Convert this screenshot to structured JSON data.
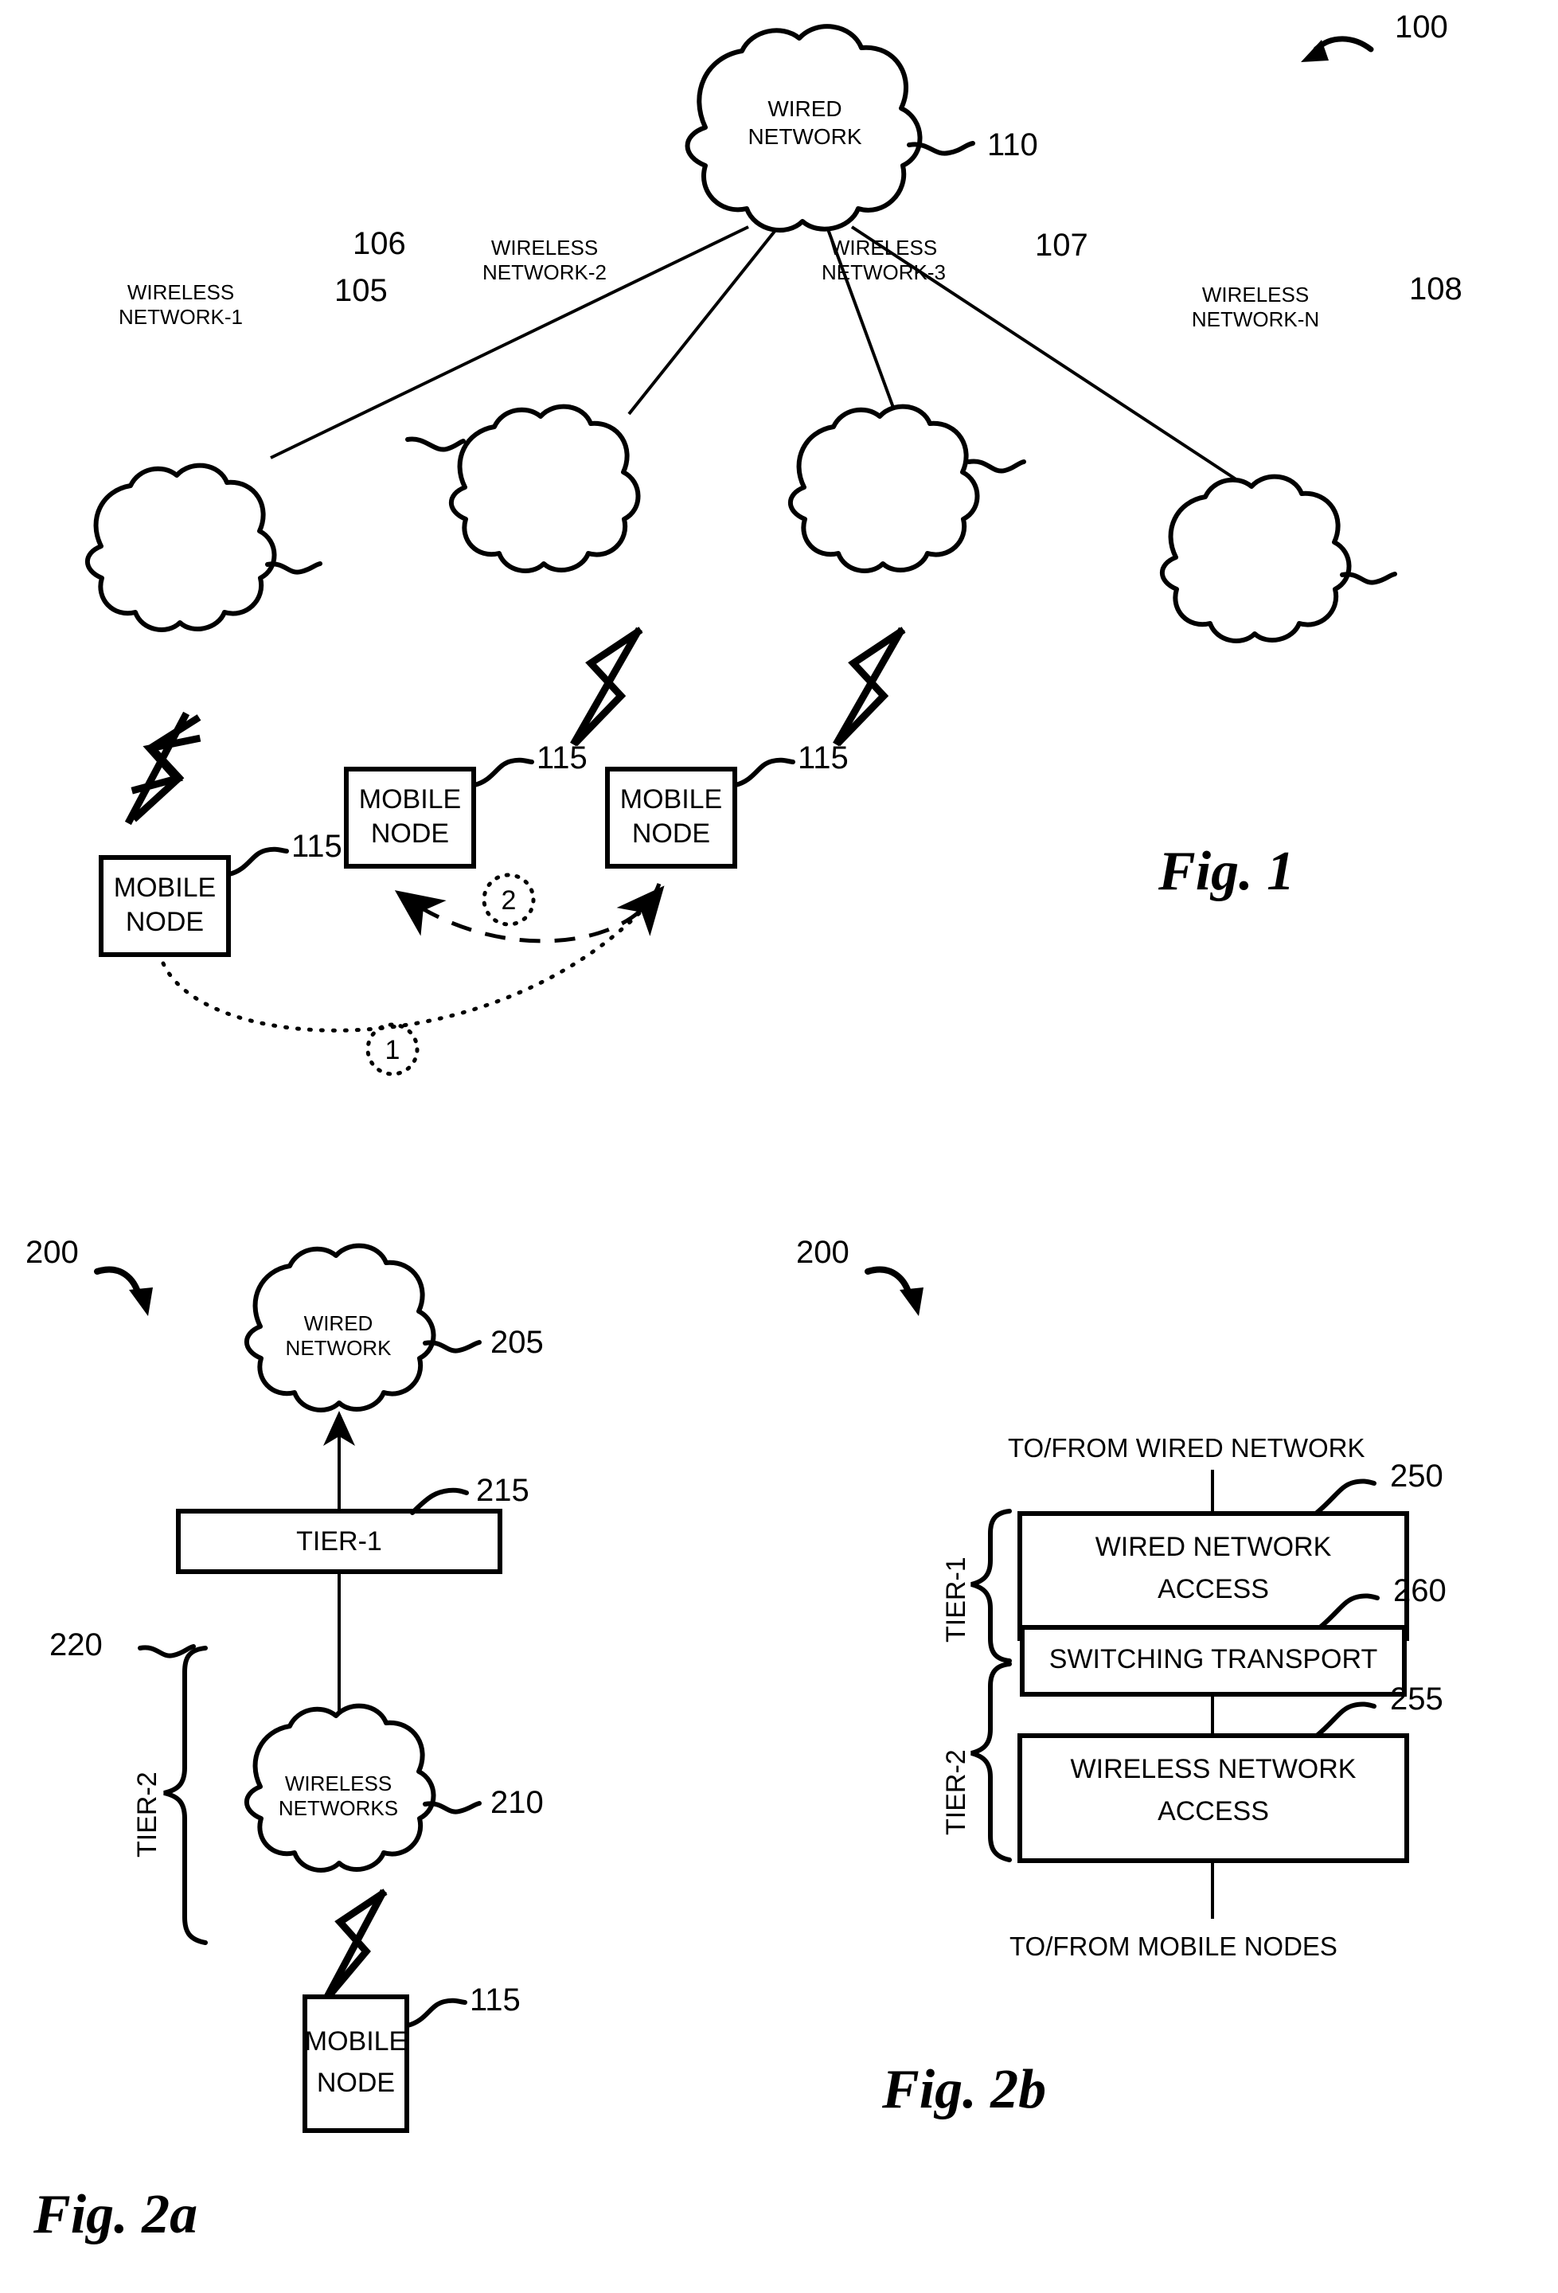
{
  "figures": [
    {
      "id": "fig1",
      "caption": "Fig. 1",
      "system_ref": "100",
      "wired_network": {
        "label_line1": "WIRED",
        "label_line2": "NETWORK",
        "ref": "110"
      },
      "wireless_networks": [
        {
          "label_line1": "WIRELESS",
          "label_line2": "NETWORK-1",
          "ref": "105"
        },
        {
          "label_line1": "WIRELESS",
          "label_line2": "NETWORK-2",
          "ref": "106"
        },
        {
          "label_line1": "WIRELESS",
          "label_line2": "NETWORK-3",
          "ref": "107"
        },
        {
          "label_line1": "WIRELESS",
          "label_line2": "NETWORK-N",
          "ref": "108"
        }
      ],
      "mobile_nodes": [
        {
          "label_line1": "MOBILE",
          "label_line2": "NODE",
          "ref": "115"
        },
        {
          "label_line1": "MOBILE",
          "label_line2": "NODE",
          "ref": "115"
        },
        {
          "label_line1": "MOBILE",
          "label_line2": "NODE",
          "ref": "115"
        }
      ],
      "handoff_steps": [
        {
          "number": "1",
          "style": "dotted"
        },
        {
          "number": "2",
          "style": "dashed"
        }
      ]
    },
    {
      "id": "fig2a",
      "caption": "Fig. 2a",
      "system_ref": "200",
      "wired_network": {
        "label_line1": "WIRED",
        "label_line2": "NETWORK",
        "ref": "205"
      },
      "tier1": {
        "label": "TIER-1",
        "ref": "215"
      },
      "wireless_networks_cloud": {
        "label_line1": "WIRELESS",
        "label_line2": "NETWORKS",
        "ref": "210"
      },
      "tier2_bracket": {
        "label": "TIER-2",
        "ref": "220"
      },
      "mobile_node": {
        "label_line1": "MOBILE",
        "label_line2": "NODE",
        "ref": "115"
      }
    },
    {
      "id": "fig2b",
      "caption": "Fig. 2b",
      "system_ref": "200",
      "top_flow_label": "TO/FROM WIRED NETWORK",
      "bottom_flow_label": "TO/FROM MOBILE NODES",
      "blocks": [
        {
          "label_line1": "WIRED NETWORK",
          "label_line2": "ACCESS",
          "ref": "250"
        },
        {
          "label_line1": "SWITCHING TRANSPORT",
          "label_line2": "",
          "ref": "260"
        },
        {
          "label_line1": "WIRELESS NETWORK",
          "label_line2": "ACCESS",
          "ref": "255"
        }
      ],
      "brackets": [
        {
          "label": "TIER-1"
        },
        {
          "label": "TIER-2"
        }
      ]
    }
  ],
  "colors": {
    "ink": "#000000",
    "paper": "#ffffff"
  }
}
